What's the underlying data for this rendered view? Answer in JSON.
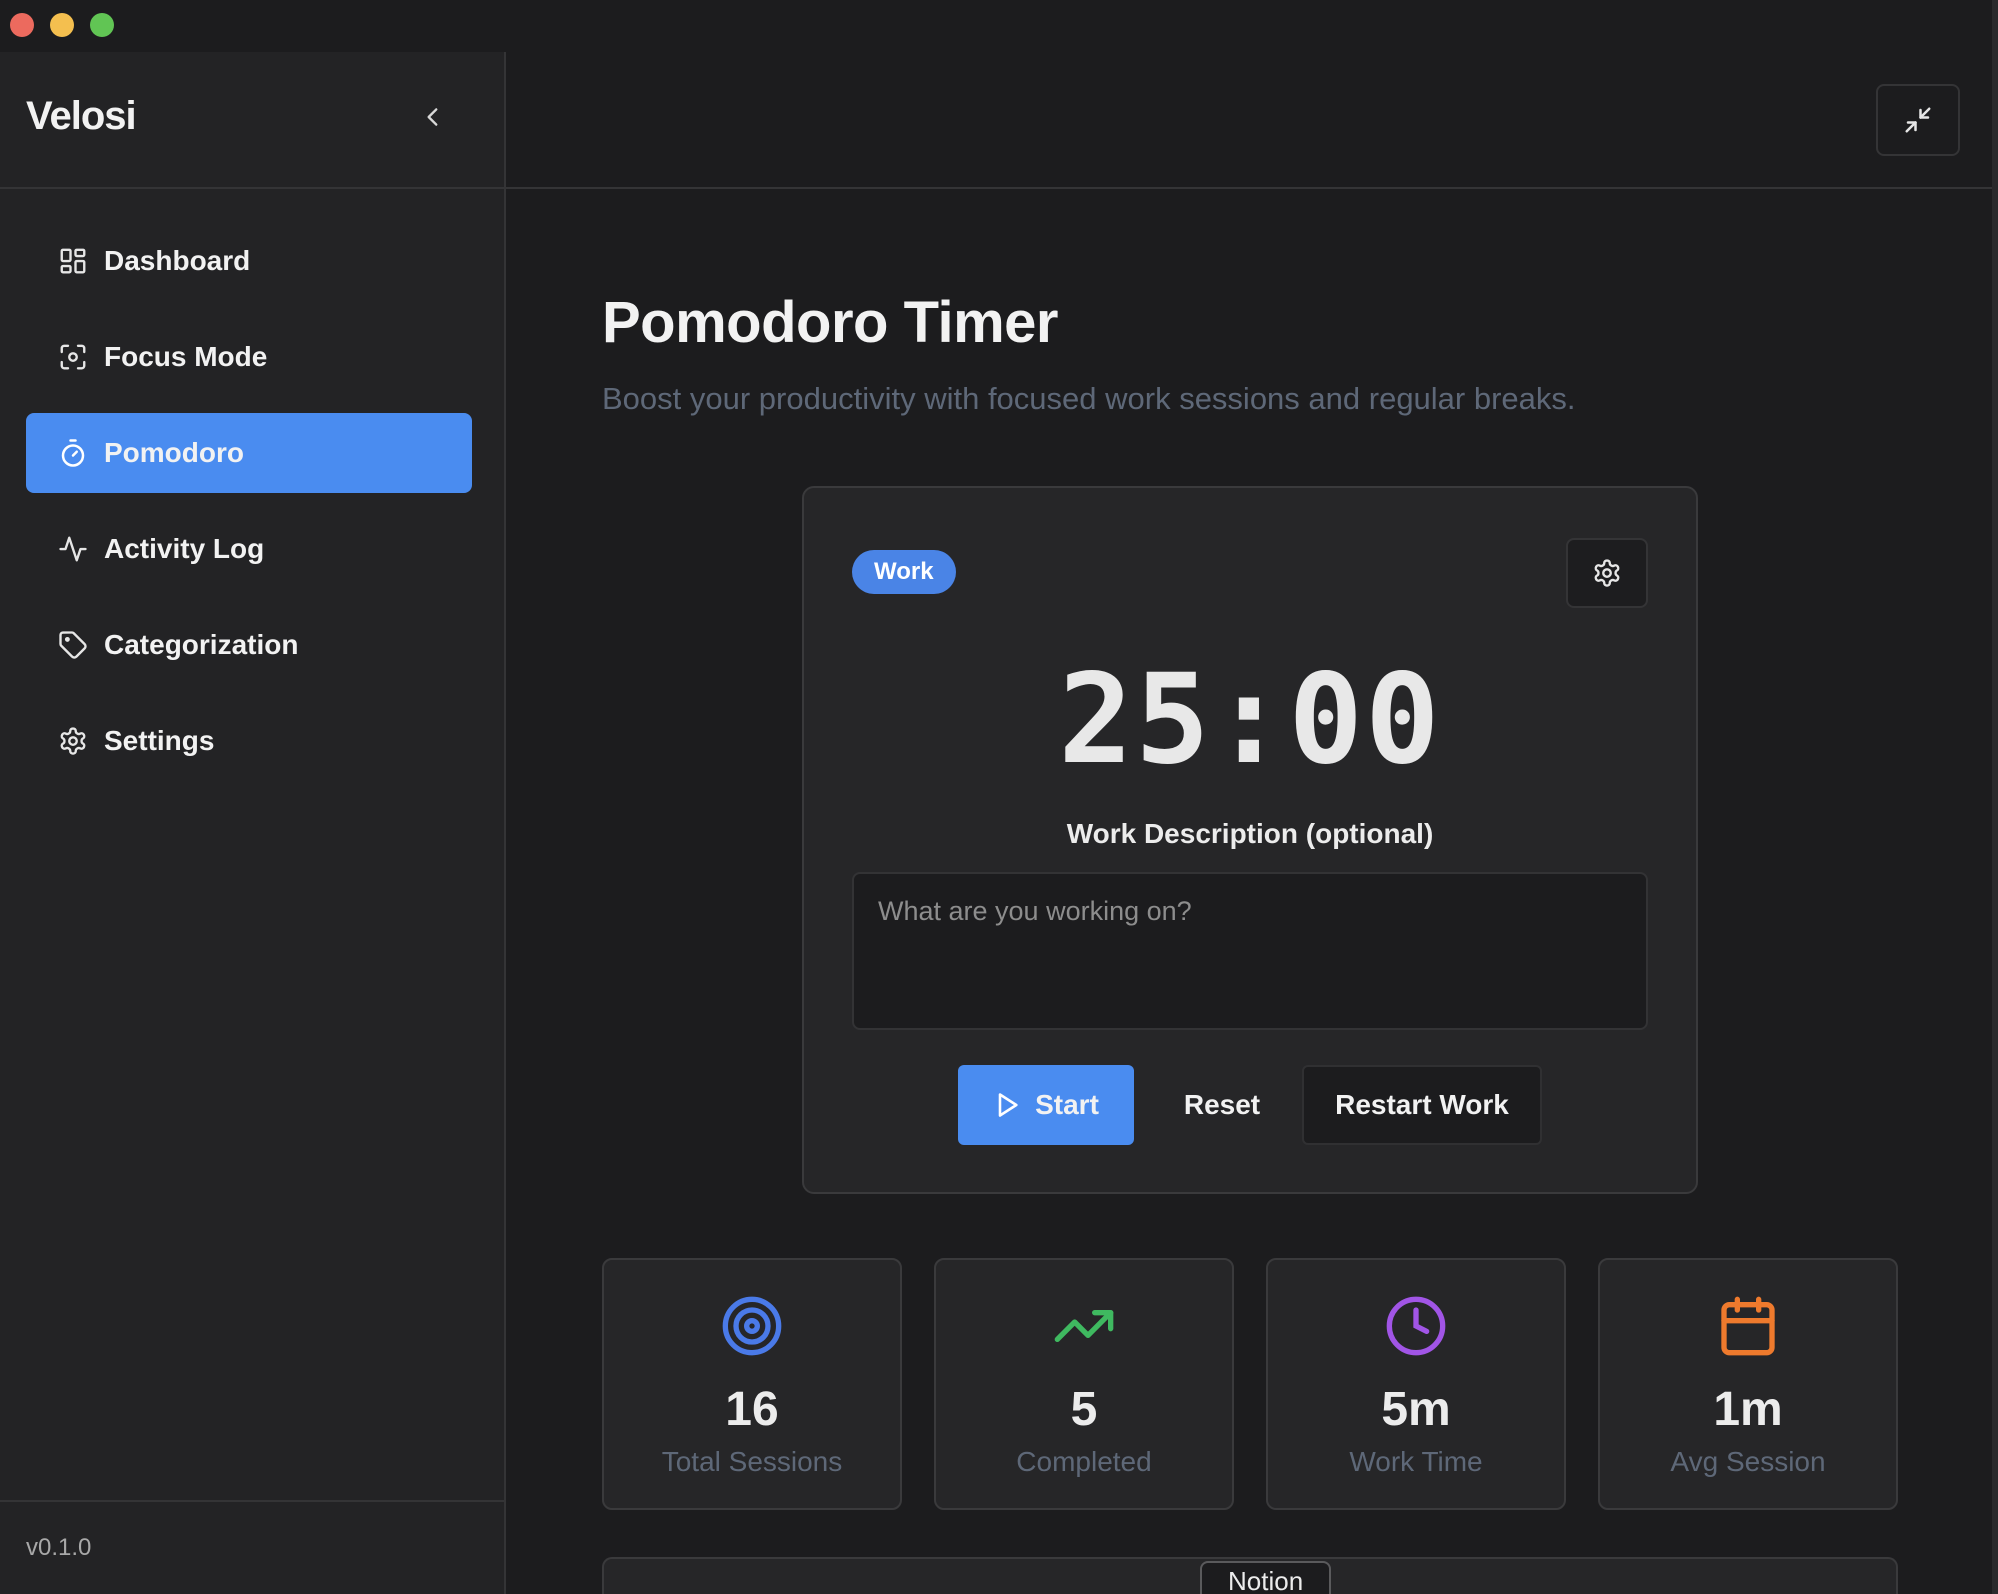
{
  "app": {
    "name": "Velosi",
    "version": "v0.1.0"
  },
  "sidebar": {
    "items": [
      {
        "label": "Dashboard",
        "icon": "dashboard-icon",
        "active": false
      },
      {
        "label": "Focus Mode",
        "icon": "focus-icon",
        "active": false
      },
      {
        "label": "Pomodoro",
        "icon": "timer-icon",
        "active": true
      },
      {
        "label": "Activity Log",
        "icon": "activity-icon",
        "active": false
      },
      {
        "label": "Categorization",
        "icon": "tag-icon",
        "active": false
      },
      {
        "label": "Settings",
        "icon": "gear-icon",
        "active": false
      }
    ]
  },
  "page": {
    "title": "Pomodoro Timer",
    "subtitle": "Boost your productivity with focused work sessions and regular breaks."
  },
  "timer": {
    "mode": "Work",
    "display": "25:00",
    "description_label": "Work Description (optional)",
    "description_placeholder": "What are you working on?",
    "description_value": "",
    "start_label": "Start",
    "reset_label": "Reset",
    "restart_label": "Restart Work"
  },
  "stats": [
    {
      "value": "16",
      "label": "Total Sessions",
      "icon": "target-icon",
      "color": "#4a7ae8"
    },
    {
      "value": "5",
      "label": "Completed",
      "icon": "trending-up-icon",
      "color": "#3fb960"
    },
    {
      "value": "5m",
      "label": "Work Time",
      "icon": "clock-icon",
      "color": "#a155e6"
    },
    {
      "value": "1m",
      "label": "Avg Session",
      "icon": "calendar-icon",
      "color": "#ee7a2d"
    }
  ],
  "bottom": {
    "tab_label": "Notion"
  },
  "colors": {
    "accent": "#4a8cf0",
    "background": "#1c1c1e",
    "card": "#262628"
  }
}
